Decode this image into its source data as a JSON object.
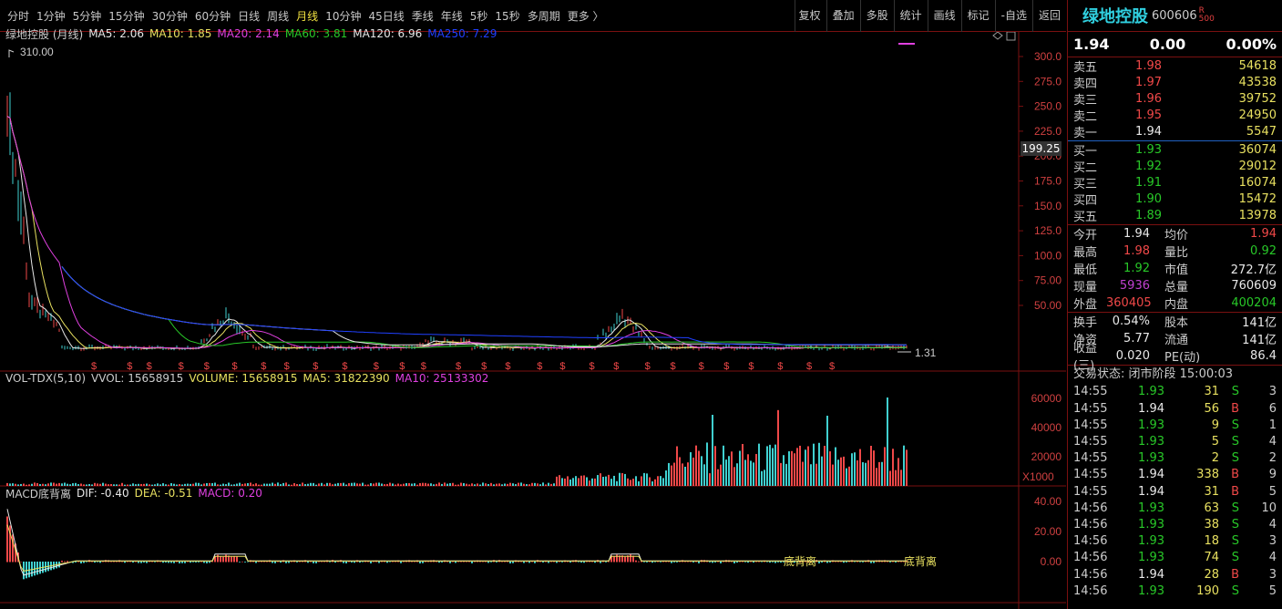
{
  "toolbar": {
    "left": [
      "分时",
      "1分钟",
      "5分钟",
      "15分钟",
      "30分钟",
      "60分钟",
      "日线",
      "周线",
      "月线",
      "10分钟",
      "45日线",
      "季线",
      "年线",
      "5秒",
      "15秒",
      "多周期",
      "更多 〉"
    ],
    "active": "月线",
    "right": [
      "复权",
      "叠加",
      "多股",
      "统计",
      "画线",
      "标记",
      "-自选",
      "返回"
    ]
  },
  "chart": {
    "title": "绿地控股 (月线)",
    "ma": [
      {
        "label": "MA5: 2.06",
        "color": "#e8e8e8"
      },
      {
        "label": "MA10: 1.85",
        "color": "#e8e060"
      },
      {
        "label": "MA20: 2.14",
        "color": "#e040e0"
      },
      {
        "label": "MA60: 3.81",
        "color": "#28c828"
      },
      {
        "label": "MA120: 6.96",
        "color": "#e8e8e8"
      },
      {
        "label": "MA250: 7.29",
        "color": "#2040ff"
      }
    ],
    "high_label": "310.00",
    "low_label": "1.31",
    "current_price_box": "199.25",
    "yaxis": [
      "300.0",
      "275.0",
      "250.0",
      "225.0",
      "200.0",
      "175.0",
      "150.0",
      "125.0",
      "100.0",
      "75.00",
      "50.00"
    ],
    "signal_mark": "$",
    "volume": {
      "header": [
        {
          "label": "VOL-TDX(5,10)",
          "color": "#ccc"
        },
        {
          "label": "VVOL: 15658915",
          "color": "#ccc"
        },
        {
          "label": "VOLUME: 15658915",
          "color": "#e8e060"
        },
        {
          "label": "MA5: 31822390",
          "color": "#e8e060"
        },
        {
          "label": "MA10: 25133302",
          "color": "#e040e0"
        }
      ],
      "yaxis": [
        "60000",
        "40000",
        "20000"
      ],
      "unit": "X1000"
    },
    "macd": {
      "header": [
        {
          "label": "MACD底背离",
          "color": "#ccc"
        },
        {
          "label": "DIF: -0.40",
          "color": "#e8e8e8"
        },
        {
          "label": "DEA: -0.51",
          "color": "#e8e060"
        },
        {
          "label": "MACD: 0.20",
          "color": "#e040e0"
        }
      ],
      "yaxis": [
        "40.00",
        "20.00",
        "0.00"
      ],
      "annotation": "底背离"
    }
  },
  "stock": {
    "name": "绿地控股",
    "code": "600606",
    "badge_top": "R",
    "badge_bottom": "500",
    "price": "1.94",
    "change": "0.00",
    "change_pct": "0.00%"
  },
  "sell": [
    {
      "label": "卖五",
      "price": "1.98",
      "vol": "54618",
      "c": "red"
    },
    {
      "label": "卖四",
      "price": "1.97",
      "vol": "43538",
      "c": "red"
    },
    {
      "label": "卖三",
      "price": "1.96",
      "vol": "39752",
      "c": "red"
    },
    {
      "label": "卖二",
      "price": "1.95",
      "vol": "24950",
      "c": "red"
    },
    {
      "label": "卖一",
      "price": "1.94",
      "vol": "5547",
      "c": "white"
    }
  ],
  "buy": [
    {
      "label": "买一",
      "price": "1.93",
      "vol": "36074",
      "c": "green"
    },
    {
      "label": "买二",
      "price": "1.92",
      "vol": "29012",
      "c": "green"
    },
    {
      "label": "买三",
      "price": "1.91",
      "vol": "16074",
      "c": "green"
    },
    {
      "label": "买四",
      "price": "1.90",
      "vol": "15472",
      "c": "green"
    },
    {
      "label": "买五",
      "price": "1.89",
      "vol": "13978",
      "c": "green"
    }
  ],
  "stats": [
    {
      "l1": "今开",
      "v1": "1.94",
      "c1": "white",
      "l2": "均价",
      "v2": "1.94",
      "c2": "red"
    },
    {
      "l1": "最高",
      "v1": "1.98",
      "c1": "red",
      "l2": "量比",
      "v2": "0.92",
      "c2": "green"
    },
    {
      "l1": "最低",
      "v1": "1.92",
      "c1": "green",
      "l2": "市值",
      "v2": "272.7亿",
      "c2": "white"
    },
    {
      "l1": "现量",
      "v1": "5936",
      "c1": "purple",
      "l2": "总量",
      "v2": "760609",
      "c2": "white"
    },
    {
      "l1": "外盘",
      "v1": "360405",
      "c1": "red",
      "l2": "内盘",
      "v2": "400204",
      "c2": "green"
    }
  ],
  "stats2": [
    {
      "l1": "换手",
      "v1": "0.54%",
      "c1": "white",
      "l2": "股本",
      "v2": "141亿",
      "c2": "white"
    },
    {
      "l1": "净资",
      "v1": "5.77",
      "c1": "white",
      "l2": "流通",
      "v2": "141亿",
      "c2": "white"
    },
    {
      "l1": "收益(三)",
      "v1": "0.020",
      "c1": "white",
      "l2": "PE(动)",
      "v2": "86.4",
      "c2": "white"
    }
  ],
  "trade_state": "交易状态: 闭市阶段 15:00:03",
  "ticks": [
    {
      "t": "14:55",
      "p": "1.93",
      "v": "31",
      "d": "S",
      "n": "3"
    },
    {
      "t": "14:55",
      "p": "1.94",
      "v": "56",
      "d": "B",
      "n": "6"
    },
    {
      "t": "14:55",
      "p": "1.93",
      "v": "9",
      "d": "S",
      "n": "1"
    },
    {
      "t": "14:55",
      "p": "1.93",
      "v": "5",
      "d": "S",
      "n": "4"
    },
    {
      "t": "14:55",
      "p": "1.93",
      "v": "2",
      "d": "S",
      "n": "2"
    },
    {
      "t": "14:55",
      "p": "1.94",
      "v": "338",
      "d": "B",
      "n": "9"
    },
    {
      "t": "14:55",
      "p": "1.94",
      "v": "31",
      "d": "B",
      "n": "5"
    },
    {
      "t": "14:56",
      "p": "1.93",
      "v": "63",
      "d": "S",
      "n": "10"
    },
    {
      "t": "14:56",
      "p": "1.93",
      "v": "38",
      "d": "S",
      "n": "4"
    },
    {
      "t": "14:56",
      "p": "1.93",
      "v": "18",
      "d": "S",
      "n": "3"
    },
    {
      "t": "14:56",
      "p": "1.93",
      "v": "74",
      "d": "S",
      "n": "4"
    },
    {
      "t": "14:56",
      "p": "1.94",
      "v": "28",
      "d": "B",
      "n": "3"
    },
    {
      "t": "14:56",
      "p": "1.93",
      "v": "190",
      "d": "S",
      "n": "5"
    }
  ]
}
